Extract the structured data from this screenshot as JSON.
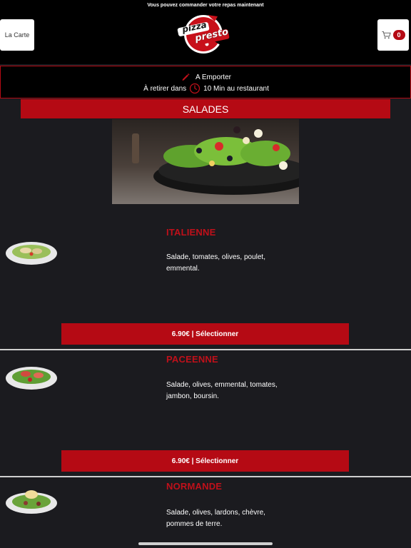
{
  "header": {
    "tagline": "Vous pouvez commander votre repas maintenant",
    "menu_label": "La Carte",
    "cart_count": "0",
    "logo_line1": "pizza",
    "logo_line2": "presto"
  },
  "order_bar": {
    "mode_label": "A Emporter",
    "pickup_prefix": "À retirer dans",
    "pickup_suffix": "10 Min au restaurant"
  },
  "category": {
    "title": "SALADES"
  },
  "products": [
    {
      "name": "ITALIENNE",
      "description": "Salade, tomates, olives, poulet, emmental.",
      "button": "6.90€ | Sélectionner"
    },
    {
      "name": "PACEENNE",
      "description": "Salade, olives, emmental, tomates, jambon, boursin.",
      "button": "6.90€ | Sélectionner"
    },
    {
      "name": "NORMANDE",
      "description": "Salade, olives, lardons, chèvre, pommes de terre."
    }
  ],
  "colors": {
    "background": "#1b1b1f",
    "accent_red": "#b50a14",
    "title_red": "#c0101a",
    "header_black": "#000000"
  },
  "icons": {
    "cart": "shopping-cart-icon",
    "pencil": "pencil-icon",
    "timer": "timer-icon"
  }
}
